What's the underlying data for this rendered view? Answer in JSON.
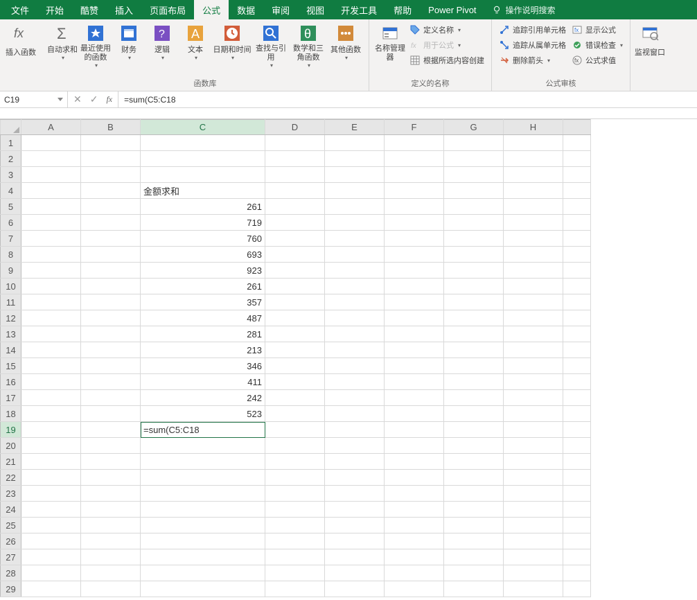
{
  "menu": {
    "items": [
      "文件",
      "开始",
      "酷赞",
      "插入",
      "页面布局",
      "公式",
      "数据",
      "审阅",
      "视图",
      "开发工具",
      "帮助",
      "Power Pivot"
    ],
    "active_index": 5,
    "tell_me": "操作说明搜索"
  },
  "ribbon": {
    "insert_fn": "插入函数",
    "autosum": "自动求和",
    "recent": "最近使用的函数",
    "financial": "财务",
    "logical": "逻辑",
    "text": "文本",
    "datetime": "日期和时间",
    "lookup": "查找与引用",
    "math": "数学和三角函数",
    "more": "其他函数",
    "group_lib": "函数库",
    "name_mgr": "名称管理器",
    "define_name": "定义名称",
    "use_in_formula": "用于公式",
    "create_from_sel": "根据所选内容创建",
    "group_names": "定义的名称",
    "trace_prec": "追踪引用单元格",
    "trace_dep": "追踪从属单元格",
    "remove_arrows": "删除箭头",
    "show_formulas": "显示公式",
    "error_check": "错误检查",
    "eval_formula": "公式求值",
    "group_audit": "公式审核",
    "watch": "监视窗口"
  },
  "formula_bar": {
    "cell_ref": "C19",
    "formula": "=sum(C5:C18"
  },
  "columns": [
    "A",
    "B",
    "C",
    "D",
    "E",
    "F",
    "G",
    "H"
  ],
  "rows": {
    "count": 29,
    "header_row": 4,
    "header_col": "C",
    "header_text": "金额求和",
    "data_start": 5,
    "data_col": "C",
    "values": [
      261,
      719,
      760,
      693,
      923,
      261,
      357,
      487,
      281,
      213,
      346,
      411,
      242,
      523
    ],
    "editing_row": 19,
    "editing_text": "=sum(C5:C18"
  }
}
